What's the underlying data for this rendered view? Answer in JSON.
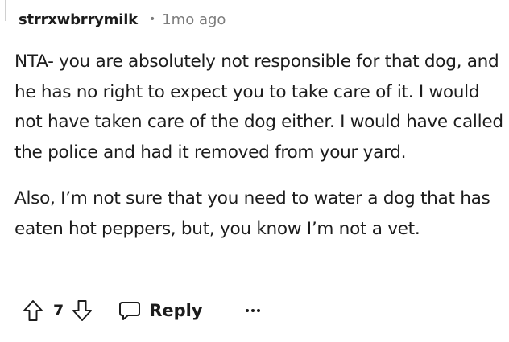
{
  "comment": {
    "username": "strrxwbrrymilk",
    "separator": "•",
    "time_ago": "1mo ago",
    "paragraphs": [
      "NTA- you are absolutely not responsible for that dog, and he has no right to expect you to take care of it. I would not have taken care of the dog either. I would have called the police and had it removed from your yard.",
      "Also, I’m not sure that you need to water a dog that has eaten hot peppers, but, you know I’m not a vet."
    ]
  },
  "actions": {
    "score": "7",
    "reply_label": "Reply",
    "upvote_icon": "arrow-up-outline",
    "downvote_icon": "arrow-down-outline",
    "reply_icon": "speech-bubble-outline",
    "more_icon": "three-dots-horizontal"
  }
}
